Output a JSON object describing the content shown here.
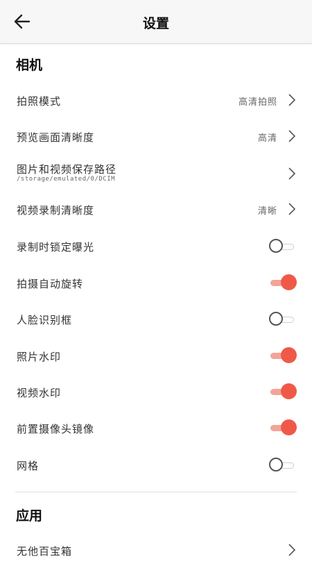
{
  "header": {
    "title": "设置"
  },
  "camera": {
    "section_title": "相机",
    "rows": [
      {
        "label": "拍照模式",
        "value": "高清拍照"
      },
      {
        "label": "预览画面清晰度",
        "value": "高清"
      },
      {
        "label": "图片和视频保存路径",
        "sub": "/storage/emulated/0/DCIM"
      },
      {
        "label": "视频录制清晰度",
        "value": "清晰"
      },
      {
        "label": "录制时锁定曝光",
        "enabled": false
      },
      {
        "label": "拍摄自动旋转",
        "enabled": true
      },
      {
        "label": "人脸识别框",
        "enabled": false
      },
      {
        "label": "照片水印",
        "enabled": true
      },
      {
        "label": "视频水印",
        "enabled": true
      },
      {
        "label": "前置摄像头镜像",
        "enabled": true
      },
      {
        "label": "网格",
        "enabled": false
      }
    ]
  },
  "app": {
    "section_title": "应用",
    "rows": [
      {
        "label": "无他百宝箱"
      }
    ]
  },
  "colors": {
    "toggle_on_knob": "#ef5a48",
    "toggle_on_track": "#f4a39a",
    "toggle_off_knob_border": "#555555"
  }
}
